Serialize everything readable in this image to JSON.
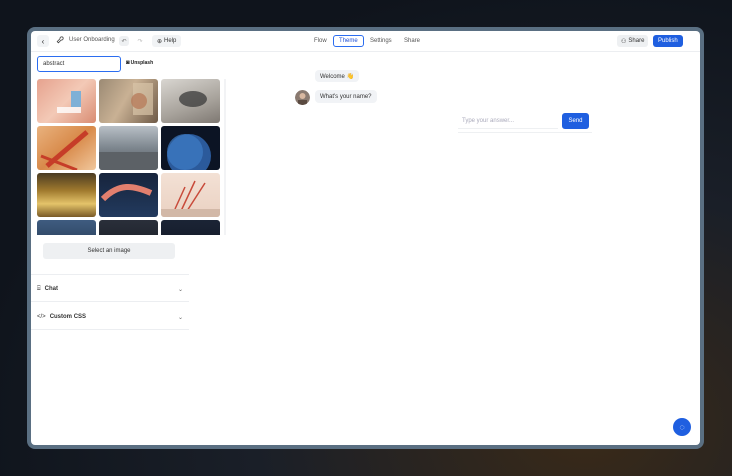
{
  "header": {
    "title": "User Onboarding",
    "help_label": "Help",
    "tabs": [
      {
        "label": "Flow"
      },
      {
        "label": "Theme"
      },
      {
        "label": "Settings"
      },
      {
        "label": "Share"
      }
    ],
    "share_label": "Share",
    "publish_label": "Publish",
    "active_tab": "Theme"
  },
  "image_search": {
    "value": "abstract",
    "provider": "Unsplash",
    "select_label": "Select an image"
  },
  "sections": [
    {
      "label": "Chat"
    },
    {
      "label": "Custom CSS"
    }
  ],
  "preview": {
    "bubble1": "Welcome 👋",
    "bubble2": "What's your name?",
    "answer_placeholder": "Type your answer...",
    "send_label": "Send"
  },
  "colors": {
    "accent": "#1f5fe0",
    "tab_active_border": "#2b6df0"
  }
}
